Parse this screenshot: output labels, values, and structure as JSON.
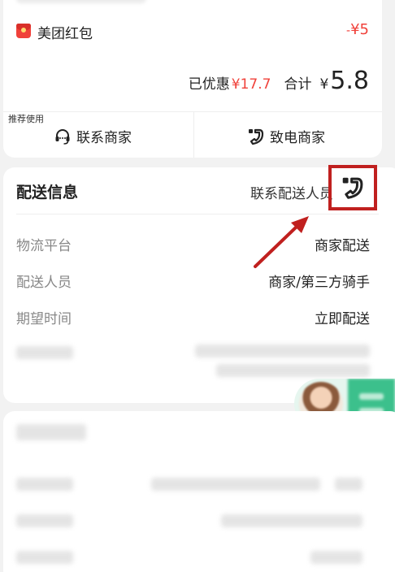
{
  "summary": {
    "red_packet_label": "美团红包",
    "red_packet_minus": "-",
    "red_packet_amount": "¥5",
    "discount_label": "已优惠",
    "discount_value": "¥17.7",
    "total_label": "合计",
    "total_currency": "¥",
    "total_value": "5.8",
    "recommend_tag": "推荐使用",
    "contact_merchant_label": "联系商家",
    "call_merchant_label": "致电商家"
  },
  "delivery": {
    "title": "配送信息",
    "contact_rider_label": "联系配送人员",
    "rows": [
      {
        "label": "物流平台",
        "value": "商家配送"
      },
      {
        "label": "配送人员",
        "value": "商家/第三方骑手"
      },
      {
        "label": "期望时间",
        "value": "立即配送"
      }
    ]
  },
  "colors": {
    "accent_red": "#f0413a",
    "highlight_box": "#c0201f",
    "assistant_green": "#3cc08c"
  },
  "icons": [
    "red-packet-icon",
    "headset-icon",
    "phone-icon",
    "avatar"
  ]
}
